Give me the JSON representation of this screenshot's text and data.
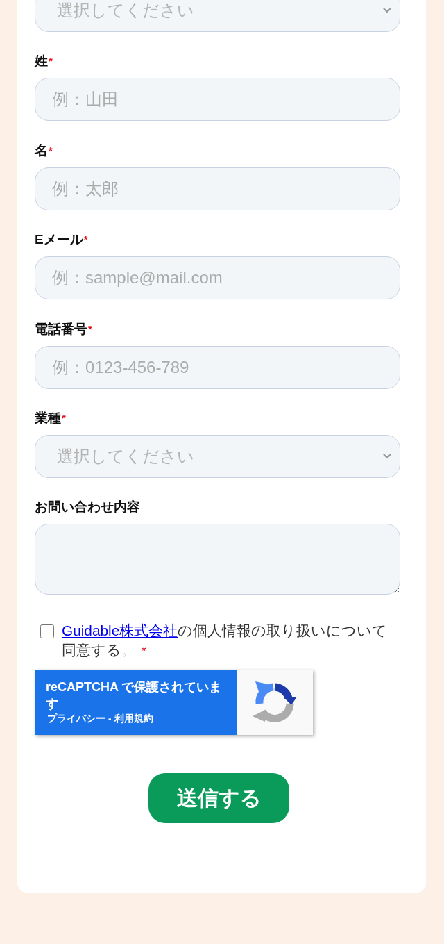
{
  "form": {
    "fields": [
      {
        "kind": "select",
        "placeholder": "選択してください"
      },
      {
        "kind": "input",
        "label": "姓",
        "required_mark": "*",
        "placeholder": "例：山田"
      },
      {
        "kind": "input",
        "label": "名",
        "required_mark": "*",
        "placeholder": "例：太郎"
      },
      {
        "kind": "input",
        "label": "Eメール",
        "required_mark": "*",
        "placeholder": "例：sample@mail.com"
      },
      {
        "kind": "input",
        "label": "電話番号",
        "required_mark": "*",
        "placeholder": "例：0123-456-789"
      },
      {
        "kind": "select",
        "label": "業種",
        "required_mark": "*",
        "placeholder": "選択してください"
      },
      {
        "kind": "textarea",
        "label": "お問い合わせ内容"
      }
    ],
    "consent": {
      "checked": false,
      "link": "Guidable株式会社",
      "text": "の個人情報の取り扱いについて同意する。",
      "required_mark": "*"
    },
    "recaptcha": {
      "title": "reCAPTCHA で保護されています",
      "links": [
        "プライバシー",
        "利用規約"
      ],
      "separator": "-"
    },
    "submit": {
      "label": "送信する"
    }
  }
}
